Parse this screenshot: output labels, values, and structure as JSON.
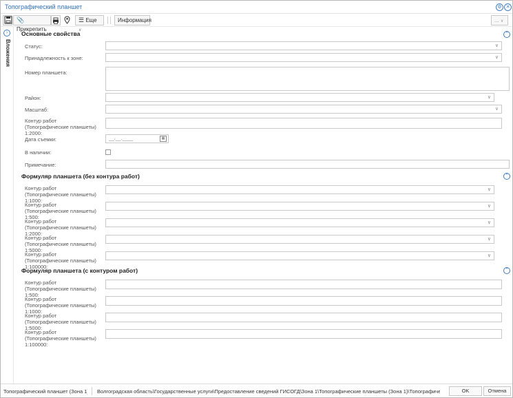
{
  "window": {
    "title": "Топографический планшет"
  },
  "toolbar": {
    "attach_label": "Прикрепить",
    "more_label": "Еще",
    "info_label": "Информация",
    "overflow_label": "..."
  },
  "left_panel": {
    "tab_label": "Вложения"
  },
  "sections": {
    "main": {
      "title": "Основные свойства",
      "fields": {
        "status": "Статус:",
        "zone": "Принадлежность к зоне:",
        "number": "Номер планшета:",
        "district": "Район:",
        "scale": "Масштаб:",
        "contour": "Контур работ (Топографические планшеты) 1:2000:",
        "survey_date": "Дата съемки:",
        "available": "В наличии:",
        "note": "Примечание:"
      },
      "date_placeholder": "__.__.____"
    },
    "form_without": {
      "title": "Формуляр планшета (без контура работ)",
      "fields": [
        "Контур работ (Топографические планшеты) 1:1000:",
        "Контур работ (Топографические планшеты) 1:500:",
        "Контур работ (Топографические планшеты) 1:2000:",
        "Контур работ (Топографические планшеты) 1:5000:",
        "Контур работ (Топографические планшеты) 1:100000:"
      ]
    },
    "form_with": {
      "title": "Формуляр планшета (с контуром работ)",
      "fields": [
        "Контур работ (Топографические планшеты) 1:500:",
        "Контур работ (Топографические планшеты) 1:1000:",
        "Контур работ (Топографические планшеты) 1:5000:",
        "Контур работ (Топографические планшеты) 1:100000:"
      ]
    }
  },
  "statusbar": {
    "left": "Топографический планшет (Зона 1)",
    "path": "Волгоградская область\\Государственные услуги\\Предоставление сведений ГИСОГД\\Зона 1\\Топографические планшеты (Зона 1)\\Топографическ...",
    "ok_label": "OK",
    "cancel_label": "Отмена"
  },
  "colors": {
    "accent": "#3f7dc4",
    "title_text": "#2e6fb8",
    "border": "#c9c9c9"
  }
}
